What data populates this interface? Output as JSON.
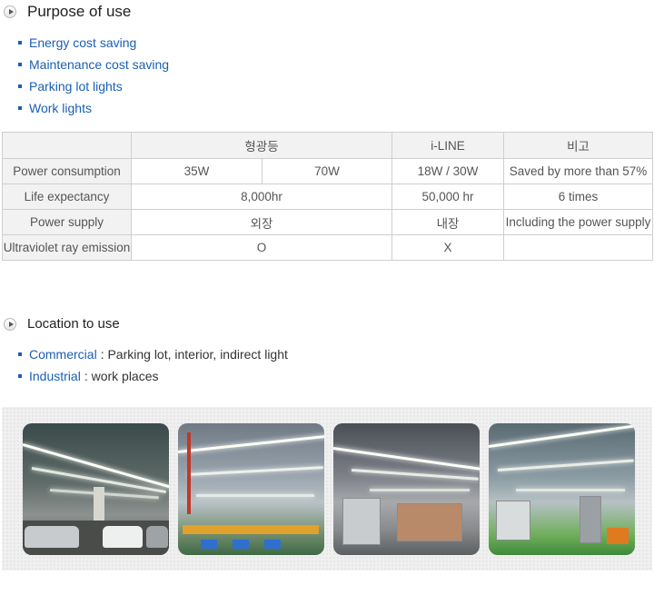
{
  "purpose": {
    "title": "Purpose of use",
    "items": [
      "Energy cost saving",
      "Maintenance cost saving",
      "Parking lot lights",
      "Work lights"
    ]
  },
  "table": {
    "header": {
      "col1": "형광등",
      "col2": "i-LINE",
      "col3": "비고"
    },
    "rows": [
      {
        "label": "Power consumption",
        "a": "35W",
        "b": "70W",
        "iline": "18W / 30W",
        "note": "Saved by more than 57%"
      },
      {
        "label": "Life expectancy",
        "ab": "8,000hr",
        "iline": "50,000 hr",
        "note": "6 times"
      },
      {
        "label": "Power supply",
        "ab": "외장",
        "iline": "내장",
        "note": "Including the power supply"
      },
      {
        "label": "Ultraviolet ray emission",
        "ab": "O",
        "iline": "X",
        "note": ""
      }
    ]
  },
  "location": {
    "title": "Location to use",
    "items": [
      {
        "category": "Commercial",
        "desc": ": Parking lot, interior, indirect light"
      },
      {
        "category": "Industrial",
        "desc": " : work places"
      }
    ]
  },
  "colors": {
    "accent": "#1a5fb4",
    "border": "#cfcfcf",
    "header_bg": "#f2f2f2"
  },
  "icons": {
    "section_marker": "play-circle-icon",
    "bullet": "square-bullet-icon"
  }
}
